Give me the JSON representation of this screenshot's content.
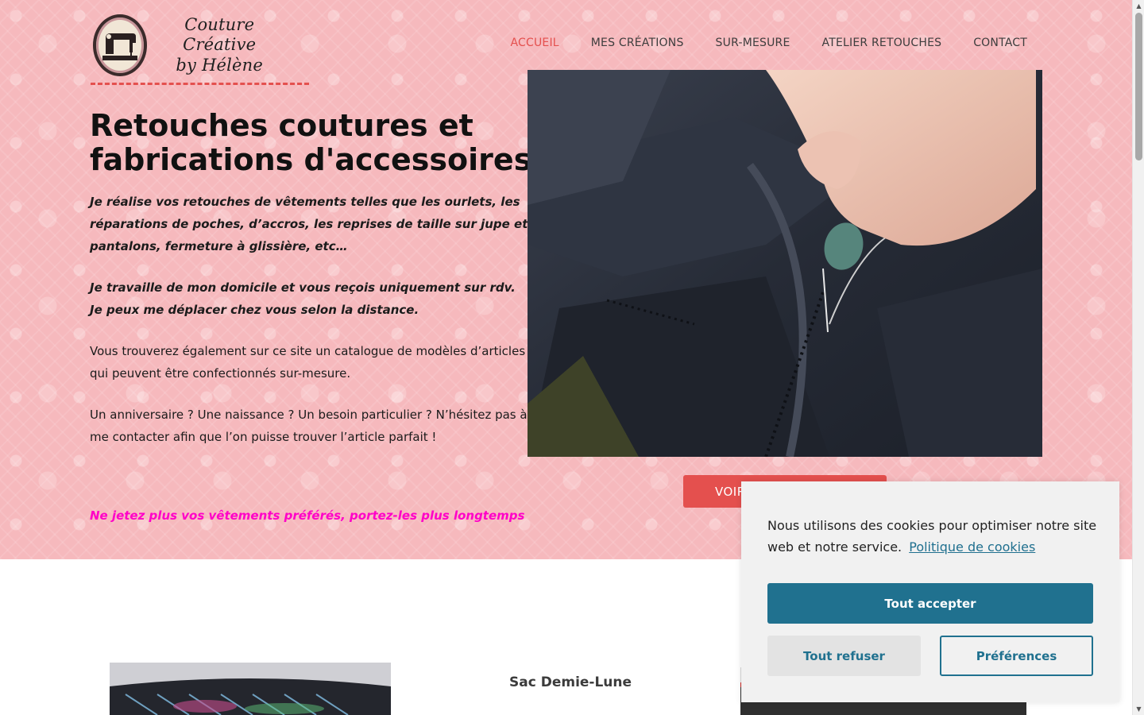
{
  "logo": {
    "line1": "Couture Créative",
    "line2": "by Hélène",
    "icon": "sewing-machine-icon"
  },
  "nav": {
    "items": [
      "ACCUEIL",
      "MES CRÉATIONS",
      "SUR-MESURE",
      "ATELIER RETOUCHES",
      "CONTACT"
    ],
    "active": "ACCUEIL",
    "active_color": "#e4504e"
  },
  "hero": {
    "title": "Retouches coutures et fabrications d'accessoires",
    "p1": "Je réalise vos retouches de vêtements telles que les ourlets, les réparations de poches, d’accros, les reprises de taille sur jupe et pantalons, fermeture à glissière, etc…",
    "p2": "Je travaille de mon domicile et vous reçois uniquement sur rdv. Je peux me déplacer chez vous selon la distance.",
    "p3": "Vous trouverez également sur ce site un catalogue de modèles d’articles qui peuvent être confectionnés sur-mesure.",
    "p4": "Un anniversaire ? Une naissance ? Un besoin particulier ?  N’hésitez pas à me contacter afin que l’on puisse trouver l’article parfait !",
    "tagline": "Ne jetez plus vos vêtements préférés, portez-les plus longtemps",
    "tagline_color": "#ff00c8",
    "cta_label": "VOIR",
    "photo": "hand-sewing-needle-photo"
  },
  "products": {
    "title": "Sac Demie-Lune",
    "left_image": "holographic-bag-photo",
    "right_image": "black-red-bag-photo"
  },
  "cookie": {
    "message": "Nous utilisons des cookies pour optimiser notre site web et notre service.",
    "policy_link": "Politique de cookies",
    "accept": "Tout accepter",
    "refuse": "Tout refuser",
    "preferences": "Préférences",
    "accent_color": "#20718f"
  },
  "colors": {
    "hero_bg": "#f6b9bd",
    "brand_red": "#e4504e"
  }
}
